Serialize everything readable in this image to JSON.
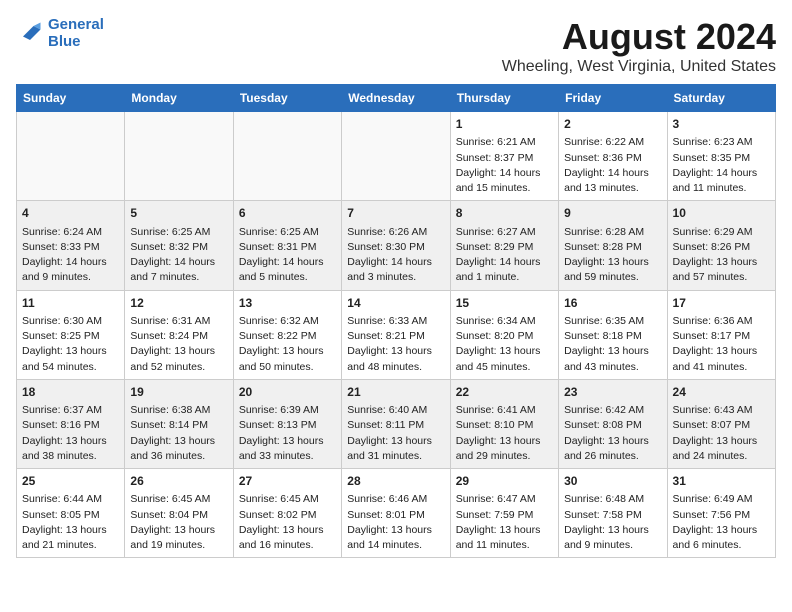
{
  "header": {
    "logo_line1": "General",
    "logo_line2": "Blue",
    "month": "August 2024",
    "location": "Wheeling, West Virginia, United States"
  },
  "weekdays": [
    "Sunday",
    "Monday",
    "Tuesday",
    "Wednesday",
    "Thursday",
    "Friday",
    "Saturday"
  ],
  "weeks": [
    [
      {
        "day": "",
        "info": ""
      },
      {
        "day": "",
        "info": ""
      },
      {
        "day": "",
        "info": ""
      },
      {
        "day": "",
        "info": ""
      },
      {
        "day": "1",
        "info": "Sunrise: 6:21 AM\nSunset: 8:37 PM\nDaylight: 14 hours\nand 15 minutes."
      },
      {
        "day": "2",
        "info": "Sunrise: 6:22 AM\nSunset: 8:36 PM\nDaylight: 14 hours\nand 13 minutes."
      },
      {
        "day": "3",
        "info": "Sunrise: 6:23 AM\nSunset: 8:35 PM\nDaylight: 14 hours\nand 11 minutes."
      }
    ],
    [
      {
        "day": "4",
        "info": "Sunrise: 6:24 AM\nSunset: 8:33 PM\nDaylight: 14 hours\nand 9 minutes."
      },
      {
        "day": "5",
        "info": "Sunrise: 6:25 AM\nSunset: 8:32 PM\nDaylight: 14 hours\nand 7 minutes."
      },
      {
        "day": "6",
        "info": "Sunrise: 6:25 AM\nSunset: 8:31 PM\nDaylight: 14 hours\nand 5 minutes."
      },
      {
        "day": "7",
        "info": "Sunrise: 6:26 AM\nSunset: 8:30 PM\nDaylight: 14 hours\nand 3 minutes."
      },
      {
        "day": "8",
        "info": "Sunrise: 6:27 AM\nSunset: 8:29 PM\nDaylight: 14 hours\nand 1 minute."
      },
      {
        "day": "9",
        "info": "Sunrise: 6:28 AM\nSunset: 8:28 PM\nDaylight: 13 hours\nand 59 minutes."
      },
      {
        "day": "10",
        "info": "Sunrise: 6:29 AM\nSunset: 8:26 PM\nDaylight: 13 hours\nand 57 minutes."
      }
    ],
    [
      {
        "day": "11",
        "info": "Sunrise: 6:30 AM\nSunset: 8:25 PM\nDaylight: 13 hours\nand 54 minutes."
      },
      {
        "day": "12",
        "info": "Sunrise: 6:31 AM\nSunset: 8:24 PM\nDaylight: 13 hours\nand 52 minutes."
      },
      {
        "day": "13",
        "info": "Sunrise: 6:32 AM\nSunset: 8:22 PM\nDaylight: 13 hours\nand 50 minutes."
      },
      {
        "day": "14",
        "info": "Sunrise: 6:33 AM\nSunset: 8:21 PM\nDaylight: 13 hours\nand 48 minutes."
      },
      {
        "day": "15",
        "info": "Sunrise: 6:34 AM\nSunset: 8:20 PM\nDaylight: 13 hours\nand 45 minutes."
      },
      {
        "day": "16",
        "info": "Sunrise: 6:35 AM\nSunset: 8:18 PM\nDaylight: 13 hours\nand 43 minutes."
      },
      {
        "day": "17",
        "info": "Sunrise: 6:36 AM\nSunset: 8:17 PM\nDaylight: 13 hours\nand 41 minutes."
      }
    ],
    [
      {
        "day": "18",
        "info": "Sunrise: 6:37 AM\nSunset: 8:16 PM\nDaylight: 13 hours\nand 38 minutes."
      },
      {
        "day": "19",
        "info": "Sunrise: 6:38 AM\nSunset: 8:14 PM\nDaylight: 13 hours\nand 36 minutes."
      },
      {
        "day": "20",
        "info": "Sunrise: 6:39 AM\nSunset: 8:13 PM\nDaylight: 13 hours\nand 33 minutes."
      },
      {
        "day": "21",
        "info": "Sunrise: 6:40 AM\nSunset: 8:11 PM\nDaylight: 13 hours\nand 31 minutes."
      },
      {
        "day": "22",
        "info": "Sunrise: 6:41 AM\nSunset: 8:10 PM\nDaylight: 13 hours\nand 29 minutes."
      },
      {
        "day": "23",
        "info": "Sunrise: 6:42 AM\nSunset: 8:08 PM\nDaylight: 13 hours\nand 26 minutes."
      },
      {
        "day": "24",
        "info": "Sunrise: 6:43 AM\nSunset: 8:07 PM\nDaylight: 13 hours\nand 24 minutes."
      }
    ],
    [
      {
        "day": "25",
        "info": "Sunrise: 6:44 AM\nSunset: 8:05 PM\nDaylight: 13 hours\nand 21 minutes."
      },
      {
        "day": "26",
        "info": "Sunrise: 6:45 AM\nSunset: 8:04 PM\nDaylight: 13 hours\nand 19 minutes."
      },
      {
        "day": "27",
        "info": "Sunrise: 6:45 AM\nSunset: 8:02 PM\nDaylight: 13 hours\nand 16 minutes."
      },
      {
        "day": "28",
        "info": "Sunrise: 6:46 AM\nSunset: 8:01 PM\nDaylight: 13 hours\nand 14 minutes."
      },
      {
        "day": "29",
        "info": "Sunrise: 6:47 AM\nSunset: 7:59 PM\nDaylight: 13 hours\nand 11 minutes."
      },
      {
        "day": "30",
        "info": "Sunrise: 6:48 AM\nSunset: 7:58 PM\nDaylight: 13 hours\nand 9 minutes."
      },
      {
        "day": "31",
        "info": "Sunrise: 6:49 AM\nSunset: 7:56 PM\nDaylight: 13 hours\nand 6 minutes."
      }
    ]
  ]
}
